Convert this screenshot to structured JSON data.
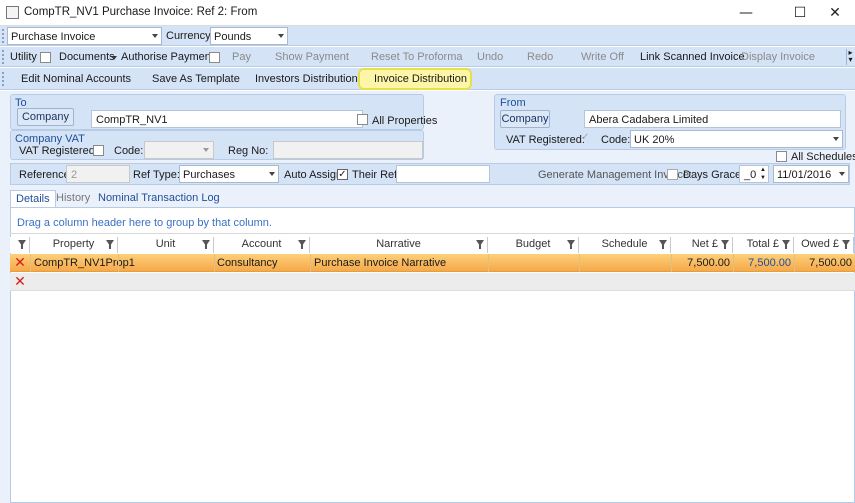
{
  "window": {
    "title": "CompTR_NV1 Purchase Invoice: Ref 2: From",
    "min": "—",
    "max": "☐",
    "close": "✕"
  },
  "toolbar1": {
    "invoice_type": "Purchase Invoice",
    "currency_label": "Currency",
    "currency_value": "Pounds"
  },
  "toolbar2": {
    "utility": "Utility",
    "documents": "Documents",
    "authorise": "Authorise Payment",
    "pay": "Pay",
    "show_payment": "Show Payment",
    "reset": "Reset To Proforma",
    "undo": "Undo",
    "redo": "Redo",
    "write_off": "Write Off",
    "link_scanned": "Link Scanned Invoice",
    "display_invoice": "Display Invoice"
  },
  "toolbar3": {
    "edit_nominal": "Edit Nominal Accounts",
    "save_template": "Save As Template",
    "investors": "Investors Distribution",
    "invoice_dist": "Invoice Distribution"
  },
  "to": {
    "heading": "To",
    "company_btn": "Company",
    "company_value": "CompTR_NV1",
    "all_properties": "All Properties"
  },
  "company_vat": {
    "heading": "Company VAT",
    "vat_registered": "VAT Registered:",
    "code": "Code:",
    "reg_no": "Reg No:"
  },
  "from": {
    "heading": "From",
    "company_btn": "Company",
    "company_value": "Abera Cadabera Limited",
    "vat_registered": "VAT Registered:",
    "code": "Code:",
    "code_value": "UK 20%",
    "all_schedules": "All Schedules"
  },
  "refrow": {
    "reference_label": "Reference:",
    "reference_value": "2",
    "ref_type_label": "Ref Type:",
    "ref_type_value": "Purchases",
    "auto_assign": "Auto Assign:",
    "their_ref": "Their Ref:",
    "gen_mgmt": "Generate Management Invoice:",
    "days_grace": "Days Grace:",
    "days_value": "_0",
    "date_value": "11/01/2016"
  },
  "tabs": [
    "Details",
    "History",
    "Nominal Transaction Log"
  ],
  "grid": {
    "group_hint": "Drag a column header here to group by that column.",
    "headers": [
      "Property",
      "Unit",
      "Account",
      "Narrative",
      "Budget",
      "Schedule",
      "Net £",
      "Total £",
      "Owed £"
    ],
    "rows": [
      {
        "property": "CompTR_NV1Prop1",
        "unit": "",
        "account": "Consultancy",
        "narrative": "Purchase Invoice Narrative",
        "budget": "",
        "schedule": "",
        "net": "7,500.00",
        "total": "7,500.00",
        "owed": "7,500.00"
      }
    ]
  }
}
